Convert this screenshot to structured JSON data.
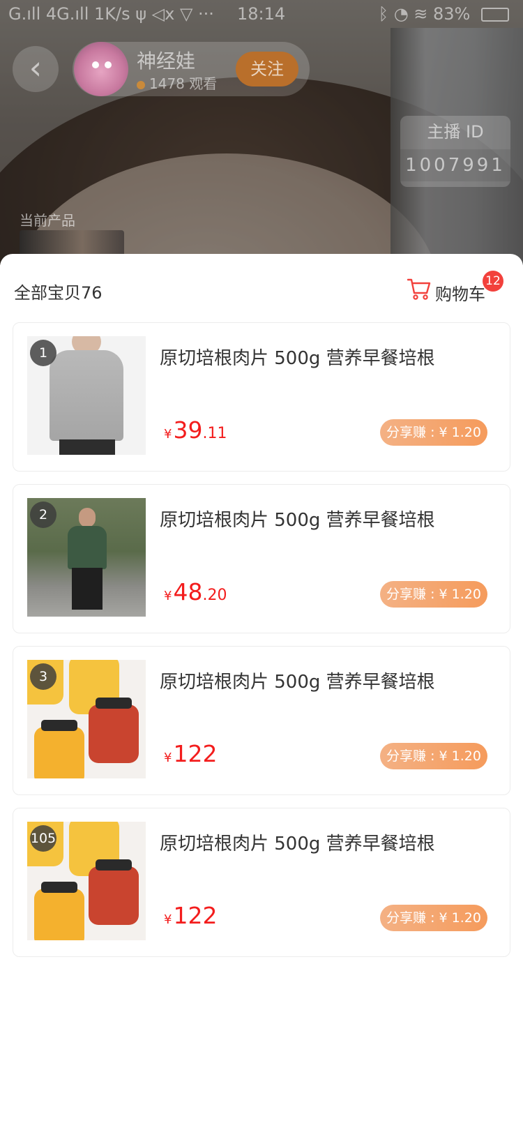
{
  "status_bar": {
    "left": "G.ıll 4G.ıll 1K/s ψ ◁x ▽ ···",
    "time": "18:14",
    "right": "ᛒ ◔ ≋ 83%"
  },
  "live_header": {
    "back_icon": "chevron-left-icon",
    "anchor_name": "神经娃",
    "viewers": "1478 观看",
    "follow_label": "关注",
    "anchor_id_label": "主播 ID",
    "anchor_id_value": "1007991",
    "current_product_label": "当前产品"
  },
  "sheet": {
    "all_items_label": "全部宝贝76",
    "cart_label": "购物车",
    "cart_badge": "12",
    "cart_icon": "shopping-cart-icon"
  },
  "products": [
    {
      "rank": "1",
      "title": "原切培根肉片 500g 营养早餐培根",
      "currency": "¥",
      "price_int": "39",
      "price_dec": ".11",
      "share": "分享赚 : ¥ 1.20",
      "image": "shirt"
    },
    {
      "rank": "2",
      "title": "原切培根肉片 500g 营养早餐培根",
      "currency": "¥",
      "price_int": "48",
      "price_dec": ".20",
      "share": "分享赚 : ¥ 1.20",
      "image": "photo"
    },
    {
      "rank": "3",
      "title": "原切培根肉片 500g 营养早餐培根",
      "currency": "¥",
      "price_int": "122",
      "price_dec": "",
      "share": "分享赚 : ¥ 1.20",
      "image": "jars"
    },
    {
      "rank": "105",
      "title": "原切培根肉片 500g 营养早餐培根",
      "currency": "¥",
      "price_int": "122",
      "price_dec": "",
      "share": "分享赚 : ¥ 1.20",
      "image": "jars"
    }
  ],
  "colors": {
    "price_red": "#f31d1d",
    "share_gradient_start": "#f4b184",
    "share_gradient_end": "#f59b5c",
    "badge_red": "#f2413c"
  }
}
